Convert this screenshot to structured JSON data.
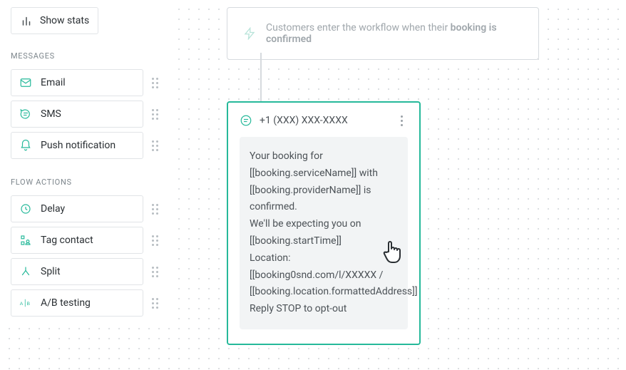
{
  "sidebar": {
    "showStats": "Show stats",
    "messagesLabel": "MESSAGES",
    "messages": [
      {
        "label": "Email"
      },
      {
        "label": "SMS"
      },
      {
        "label": "Push notification"
      }
    ],
    "flowActionsLabel": "FLOW ACTIONS",
    "flowActions": [
      {
        "label": "Delay"
      },
      {
        "label": "Tag contact"
      },
      {
        "label": "Split"
      },
      {
        "label": "A/B testing"
      }
    ]
  },
  "entry": {
    "prefix": "Customers enter the workflow when their ",
    "bold": "booking is confirmed"
  },
  "smsCard": {
    "from": "+1 (XXX) XXX-XXXX",
    "body": "Your booking for [[booking.serviceName]] with [[booking.providerName]] is confirmed.\nWe'll be expecting you on [[booking.startTime]]\nLocation: [[booking0snd.com/l/XXXXX / [[booking.location.formattedAddress]]\nReply STOP to opt-out"
  }
}
